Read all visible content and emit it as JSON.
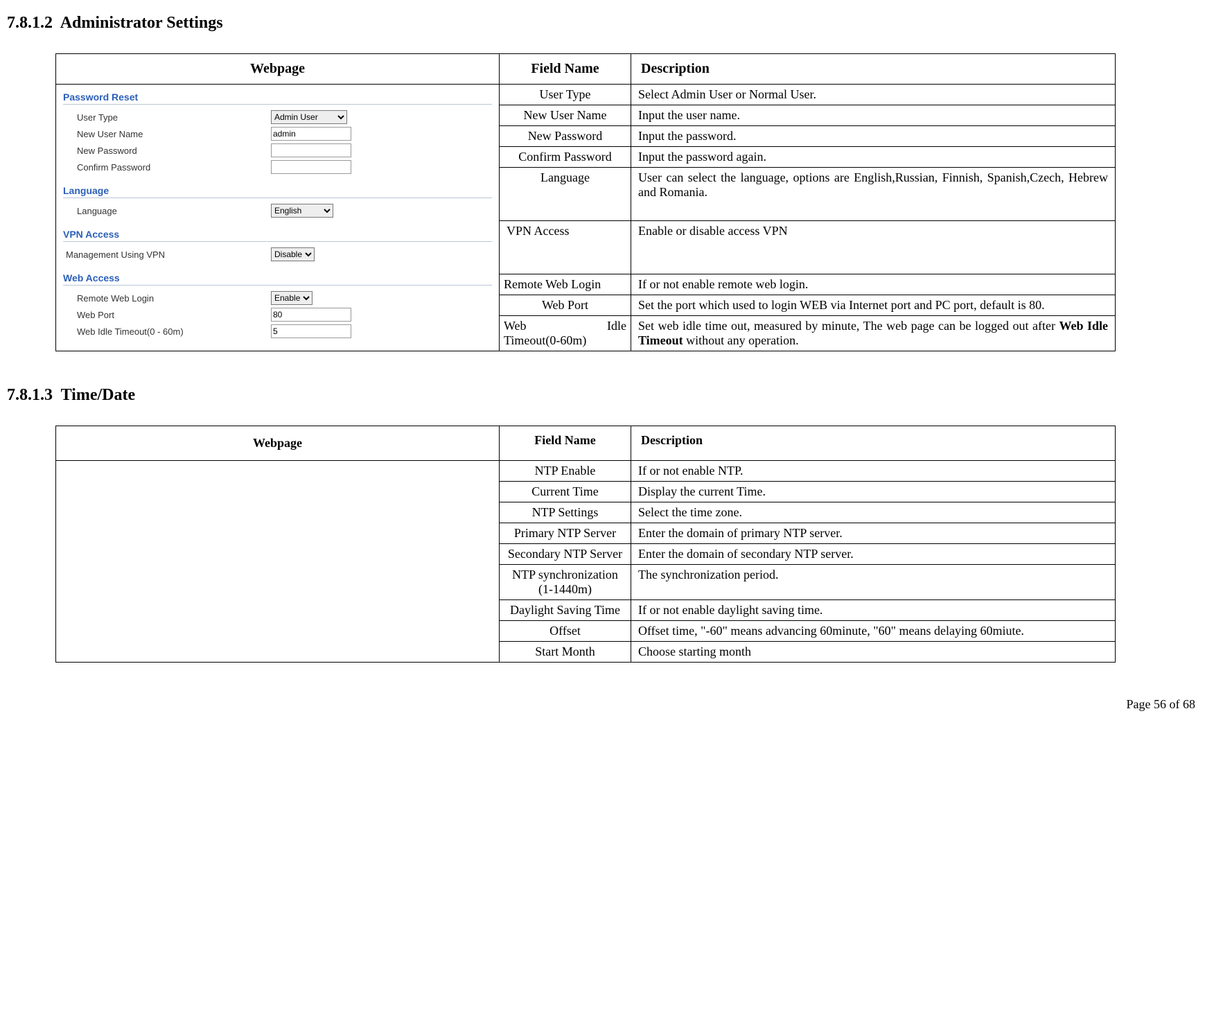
{
  "sections": {
    "s1": {
      "number": "7.8.1.2",
      "title": "Administrator Settings"
    },
    "s2": {
      "number": "7.8.1.3",
      "title": "Time/Date"
    }
  },
  "t1": {
    "headers": {
      "h1": "Webpage",
      "h2": "Field Name",
      "h3": "Description"
    },
    "rows": {
      "r1": {
        "field": "User Type",
        "desc": "Select Admin User or Normal User."
      },
      "r2": {
        "field": "New User Name",
        "desc": "Input the user name."
      },
      "r3": {
        "field": "New Password",
        "desc": "Input the password."
      },
      "r4": {
        "field": "Confirm Password",
        "desc": "Input the password again."
      },
      "r5": {
        "field": "Language",
        "desc": "User can select the language, options are English,Russian, Finnish, Spanish,Czech, Hebrew and Romania."
      },
      "r6": {
        "field": "VPN Access",
        "desc": "Enable or disable access VPN"
      },
      "r7": {
        "field": "Remote Web Login",
        "desc": "If or not enable remote web login."
      },
      "r8": {
        "field": "Web Port",
        "desc": "Set the port which used to login WEB via Internet port and PC port, default is 80."
      },
      "r9": {
        "field_left": "Web",
        "field_right": "Idle",
        "field_line2": "Timeout(0-60m)",
        "desc_pre": "Set web idle time out, measured by minute, The web page can be logged out after ",
        "desc_bold": "Web Idle Timeout",
        "desc_post": " without any operation."
      }
    }
  },
  "t2": {
    "headers": {
      "h1": "Webpage",
      "h2": "Field Name",
      "h3": "Description"
    },
    "rows": {
      "r1": {
        "field": "NTP Enable",
        "desc": "If or not enable NTP."
      },
      "r2": {
        "field": "Current Time",
        "desc": "Display the current Time."
      },
      "r3": {
        "field": "NTP Settings",
        "desc": "Select the time zone."
      },
      "r4": {
        "field": "Primary NTP Server",
        "desc": "Enter the domain of primary NTP server."
      },
      "r5": {
        "field": "Secondary NTP Server",
        "desc": "Enter the domain of secondary NTP server."
      },
      "r6": {
        "field": "NTP synchronization (1-1440m)",
        "desc": "The synchronization period."
      },
      "r7": {
        "field": "Daylight Saving Time",
        "desc": "If or not enable daylight saving time."
      },
      "r8": {
        "field": "Offset",
        "desc": "Offset time, \"-60\" means advancing 60minute, \"60\" means delaying 60miute."
      },
      "r9": {
        "field": "Start Month",
        "desc": "Choose starting month"
      }
    }
  },
  "webpage_form": {
    "panels": {
      "p1": {
        "title": "Password Reset",
        "fields": {
          "user_type_label": "User Type",
          "user_type_value": "Admin User",
          "new_user_name_label": "New User Name",
          "new_user_name_value": "admin",
          "new_password_label": "New Password",
          "confirm_password_label": "Confirm Password"
        }
      },
      "p2": {
        "title": "Language",
        "fields": {
          "language_label": "Language",
          "language_value": "English"
        }
      },
      "p3": {
        "title": "VPN Access",
        "fields": {
          "vpn_label": "Management Using VPN",
          "vpn_value": "Disable"
        }
      },
      "p4": {
        "title": "Web Access",
        "fields": {
          "remote_label": "Remote Web Login",
          "remote_value": "Enable",
          "web_port_label": "Web Port",
          "web_port_value": "80",
          "idle_label": "Web Idle Timeout(0 - 60m)",
          "idle_value": "5"
        }
      }
    }
  },
  "footer": {
    "text": "Page 56 of 68"
  }
}
